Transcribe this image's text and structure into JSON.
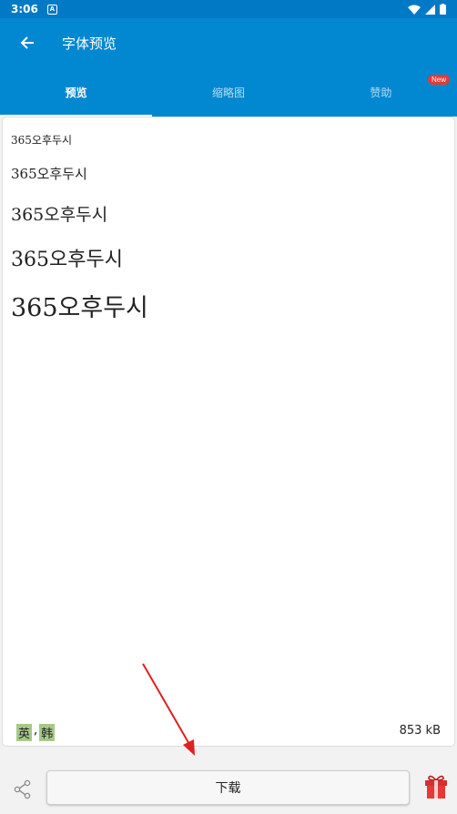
{
  "status": {
    "time": "3:06",
    "a_badge": "A"
  },
  "app_bar": {
    "title": "字体预览"
  },
  "tabs": [
    {
      "label": "预览",
      "active": true
    },
    {
      "label": "缩略图",
      "active": false
    },
    {
      "label": "赞助",
      "active": false,
      "badge": "New"
    }
  ],
  "preview": {
    "samples": [
      "365오후두시",
      "365오후두시",
      "365오후두시",
      "365오후두시",
      "365오후두시"
    ],
    "languages": [
      "英",
      "韩"
    ],
    "lang_separator": ",",
    "file_size": "853 kB"
  },
  "bottom": {
    "download_label": "下载"
  },
  "colors": {
    "primary": "#0288d1",
    "status_bar": "#0179c4",
    "lang_tag": "#a5c98a",
    "badge": "#e53935",
    "arrow": "#e02020"
  }
}
